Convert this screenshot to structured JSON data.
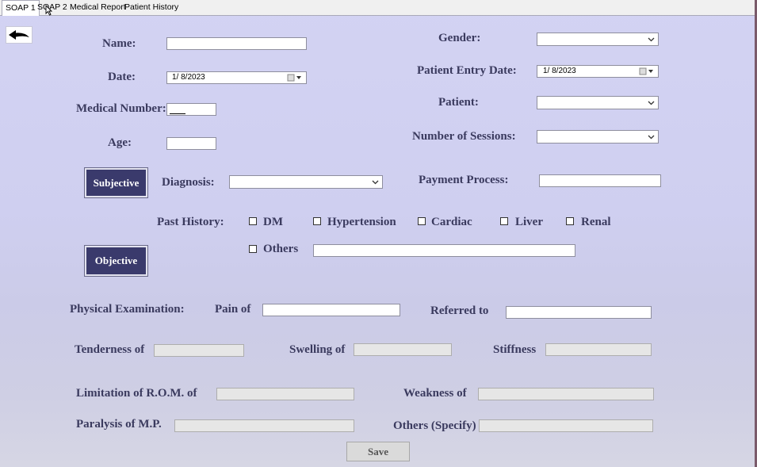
{
  "tabs": [
    "SOAP 1",
    "SOAP 2",
    "Medical Report",
    "Patient History"
  ],
  "form": {
    "name_label": "Name:",
    "date_label": "Date:",
    "date_value": "1/ 8/2023",
    "medical_number_label": "Medical Number:",
    "age_label": "Age:",
    "gender_label": "Gender:",
    "entry_date_label": "Patient Entry Date:",
    "entry_date_value": "1/ 8/2023",
    "patient_label": "Patient:",
    "sessions_label": "Number of Sessions:",
    "subjective_button": "Subjective",
    "diagnosis_label": "Diagnosis:",
    "payment_label": "Payment Process:",
    "past_history_label": "Past History:",
    "history_options": [
      "DM",
      "Hypertension",
      "Cardiac",
      "Liver",
      "Renal"
    ],
    "others_label": "Others",
    "objective_button": "Objective",
    "physical_exam_label": "Physical Examination:",
    "pain_label": "Pain of",
    "referred_label": "Referred to",
    "tenderness_label": "Tenderness of",
    "swelling_label": "Swelling of",
    "stiffness_label": "Stiffness",
    "limitation_label": "Limitation of R.O.M. of",
    "weakness_label": "Weakness of",
    "paralysis_label": "Paralysis of M.P.",
    "others_specify_label": "Others (Specify)",
    "save_button": "Save"
  },
  "icons": {
    "back": "back-arrow-icon",
    "dropdown": "chevron-down-icon",
    "calendar": "calendar-icon"
  }
}
